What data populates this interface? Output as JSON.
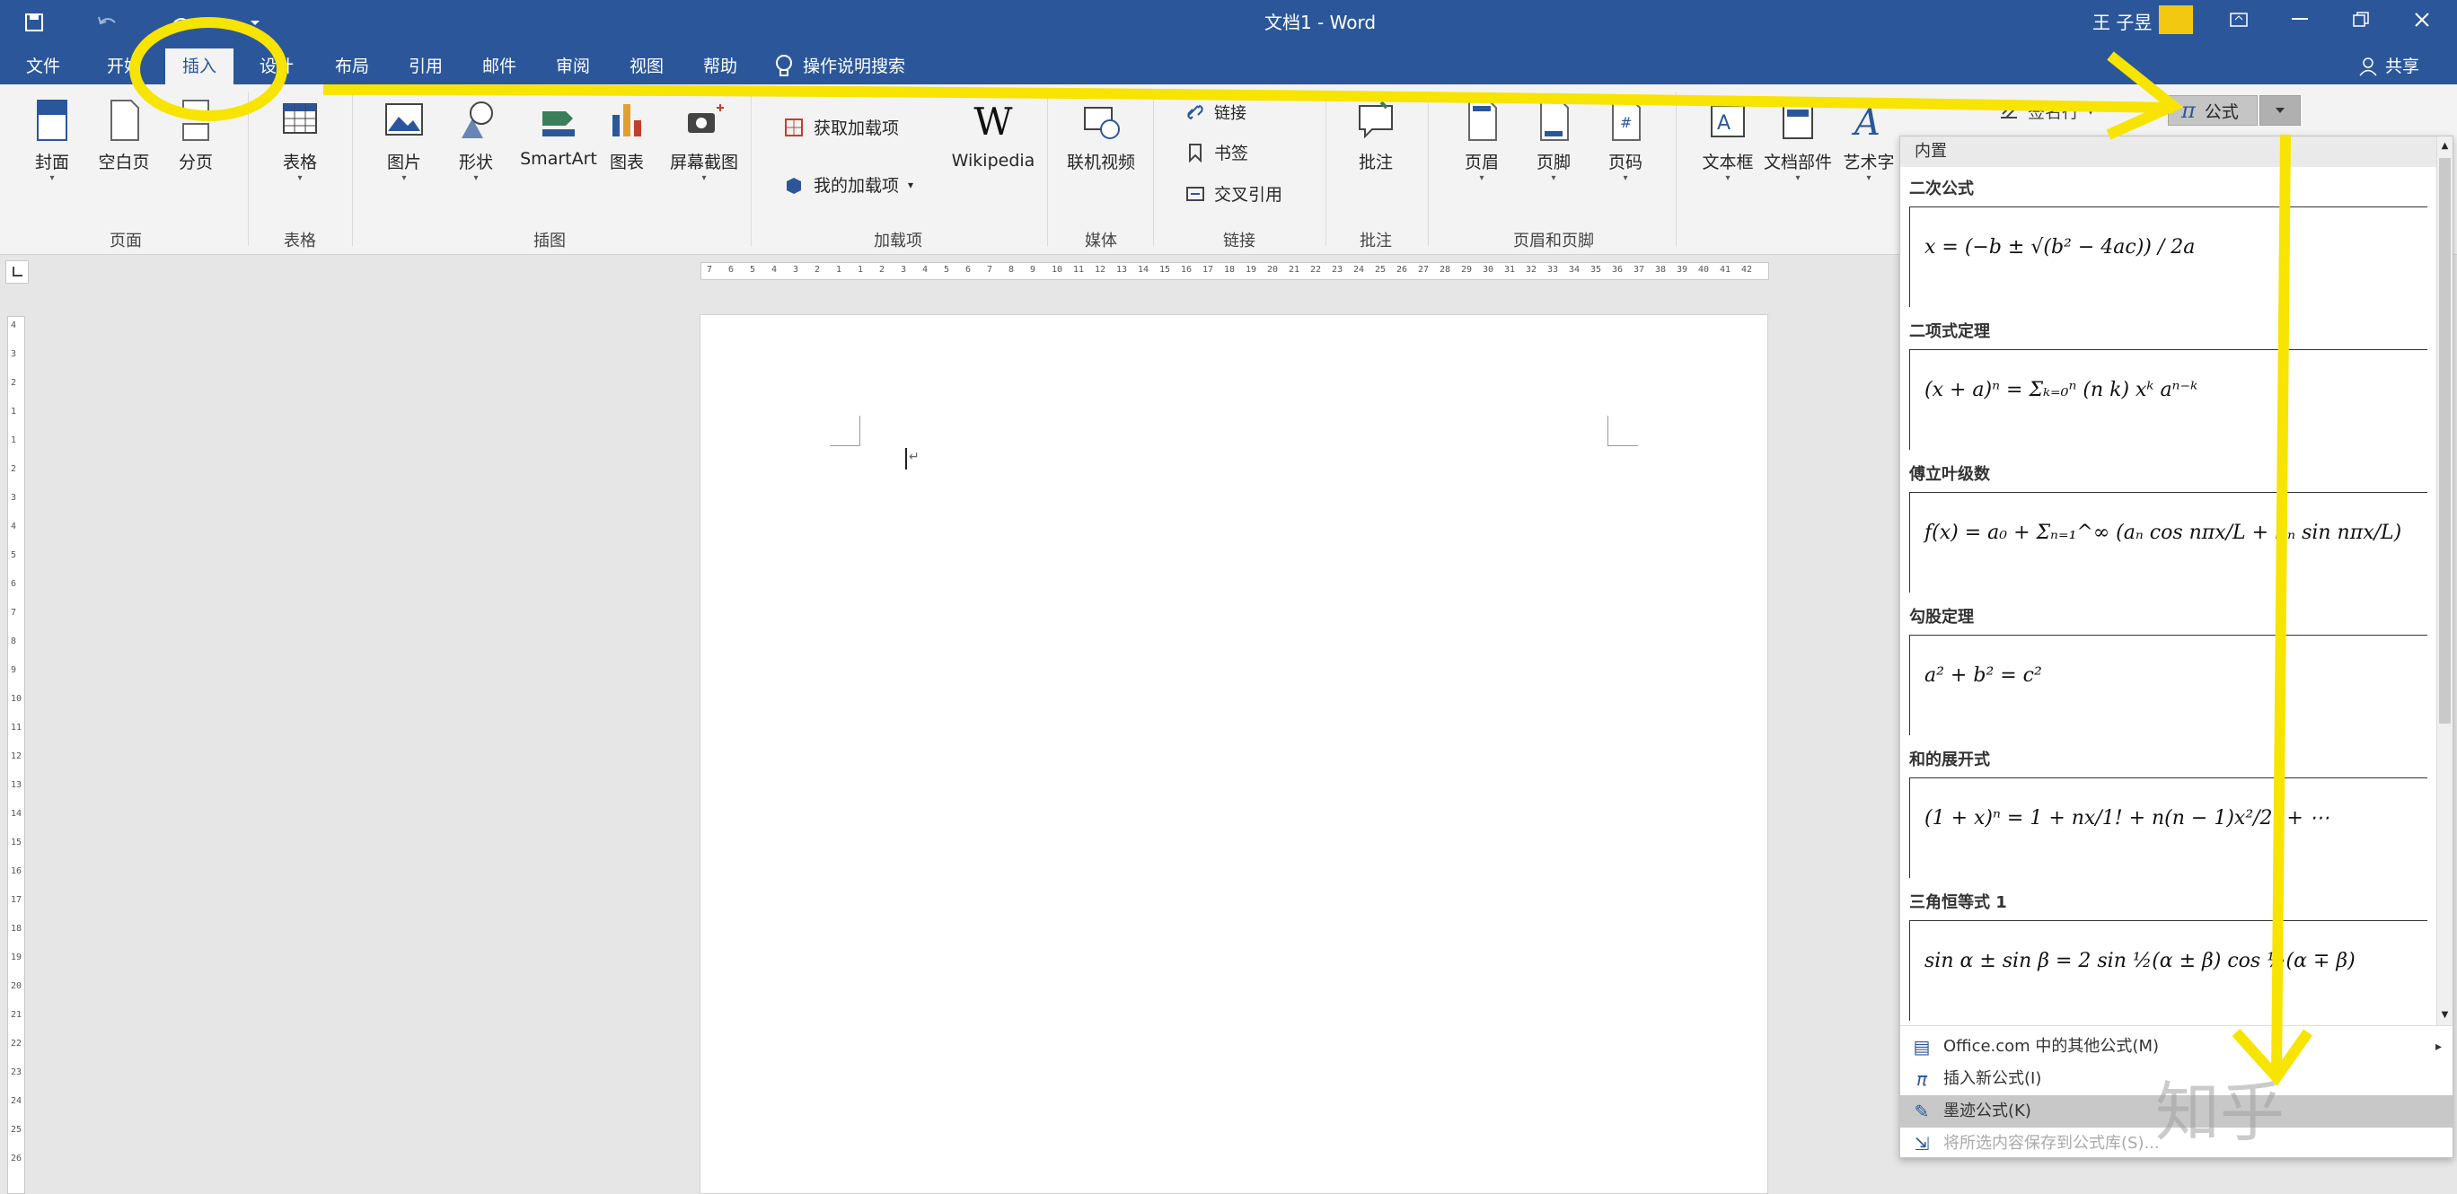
{
  "window": {
    "title": "文档1 - Word",
    "user": "王 子昱",
    "avatar_color": "#f2c811",
    "accent": "#2b579a"
  },
  "qat": {
    "icons": [
      "save-icon",
      "undo-icon",
      "redo-icon",
      "customize-icon"
    ]
  },
  "tabs": [
    {
      "label": "文件"
    },
    {
      "label": "开始"
    },
    {
      "label": "插入",
      "active": true
    },
    {
      "label": "设计"
    },
    {
      "label": "布局"
    },
    {
      "label": "引用"
    },
    {
      "label": "邮件"
    },
    {
      "label": "审阅"
    },
    {
      "label": "视图"
    },
    {
      "label": "帮助"
    }
  ],
  "tell_me": "操作说明搜索",
  "share": "共享",
  "ribbon": {
    "groups": [
      {
        "label": "页面"
      },
      {
        "label": "表格"
      },
      {
        "label": "插图"
      },
      {
        "label": "加载项"
      },
      {
        "label": "媒体"
      },
      {
        "label": "链接"
      },
      {
        "label": "批注"
      },
      {
        "label": "页眉和页脚"
      }
    ],
    "buttons": {
      "cover": "封面",
      "blank": "空白页",
      "break": "分页",
      "table": "表格",
      "picture": "图片",
      "shapes": "形状",
      "smartart": "SmartArt",
      "chart": "图表",
      "screenshot": "屏幕截图",
      "get_addins": "获取加载项",
      "my_addins": "我的加载项",
      "wikipedia": "Wikipedia",
      "video": "联机视频",
      "link": "链接",
      "bookmark": "书签",
      "crossref": "交叉引用",
      "comment": "批注",
      "header": "页眉",
      "footer": "页脚",
      "pagenum": "页码",
      "textbox": "文本框",
      "quickparts": "文档部件",
      "wordart": "艺术字",
      "signature": "签名行",
      "equation": "公式"
    }
  },
  "ruler": {
    "ticks": [
      "7",
      "6",
      "5",
      "4",
      "3",
      "2",
      "1",
      "1",
      "2",
      "3",
      "4",
      "5",
      "6",
      "7",
      "8",
      "9",
      "10",
      "11",
      "12",
      "13",
      "14",
      "15",
      "16",
      "17",
      "18",
      "19",
      "20",
      "21",
      "22",
      "23",
      "24",
      "25",
      "26",
      "27",
      "28",
      "29",
      "30",
      "31",
      "32",
      "33",
      "34",
      "35",
      "36",
      "37",
      "38",
      "39",
      "40",
      "41",
      "42"
    ]
  },
  "vruler": {
    "ticks": [
      "4",
      "3",
      "2",
      "1",
      "1",
      "2",
      "3",
      "4",
      "5",
      "6",
      "7",
      "8",
      "9",
      "10",
      "11",
      "12",
      "13",
      "14",
      "15",
      "16",
      "17",
      "18",
      "19",
      "20",
      "21",
      "22",
      "23",
      "24",
      "25",
      "26"
    ]
  },
  "gallery": {
    "header": "内置",
    "equations": [
      {
        "title": "二次公式",
        "formula": "x = (−b ± √(b² − 4ac)) / 2a"
      },
      {
        "title": "二项式定理",
        "formula": "(x + a)ⁿ = Σₖ₌₀ⁿ (n k) xᵏ aⁿ⁻ᵏ"
      },
      {
        "title": "傅立叶级数",
        "formula": "f(x) = a₀ + Σₙ₌₁^∞ (aₙ cos nπx/L + bₙ sin nπx/L)"
      },
      {
        "title": "勾股定理",
        "formula": "a² + b² = c²"
      },
      {
        "title": "和的展开式",
        "formula": "(1 + x)ⁿ = 1 + nx/1! + n(n − 1)x²/2! + ⋯"
      },
      {
        "title": "三角恒等式 1",
        "formula": "sin α ± sin β = 2 sin ½(α ± β) cos ½(α ∓ β)"
      }
    ],
    "menu": [
      {
        "label": "Office.com 中的其他公式(M)",
        "icon": "office-equations-icon"
      },
      {
        "label": "插入新公式(I)",
        "icon": "pi-icon"
      },
      {
        "label": "墨迹公式(K)",
        "icon": "ink-equation-icon",
        "highlighted": true
      },
      {
        "label": "将所选内容保存到公式库(S)...",
        "icon": "save-equation-icon",
        "disabled": true
      }
    ]
  },
  "watermark": "知乎",
  "annotation_color": "#f7e400"
}
